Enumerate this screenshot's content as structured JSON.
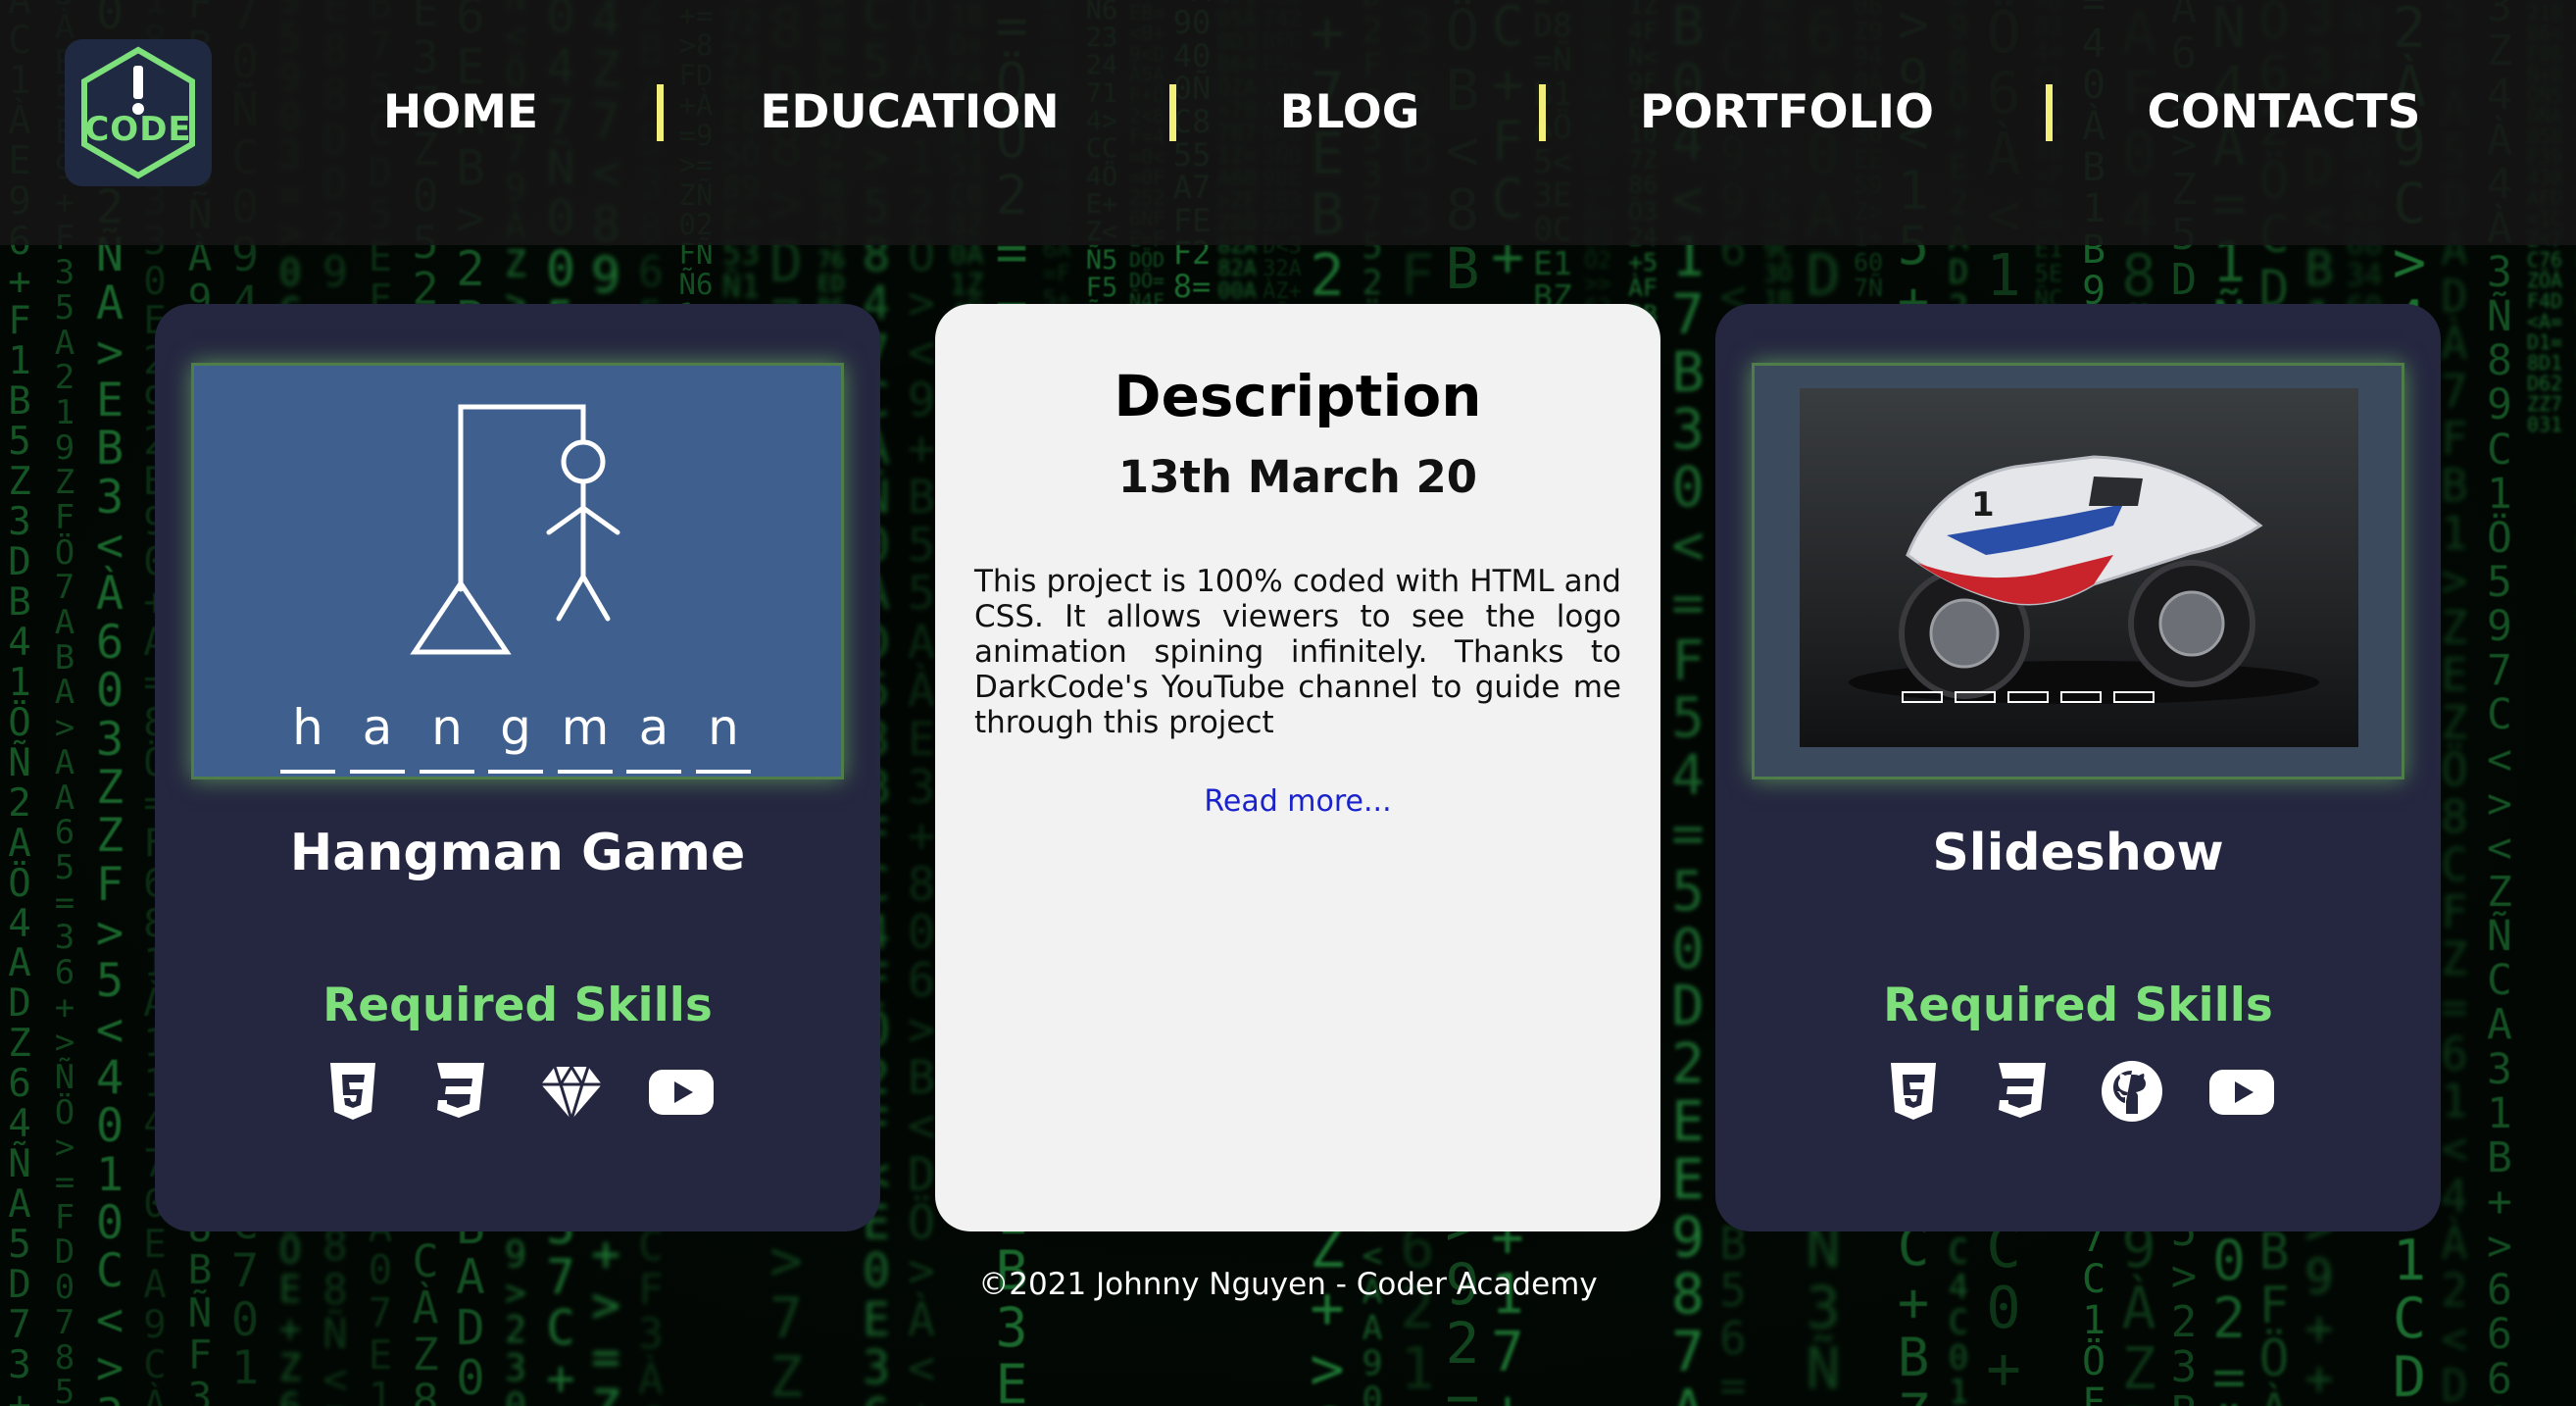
{
  "nav": {
    "logo_text": "CODE",
    "items": [
      {
        "label": "HOME"
      },
      {
        "label": "EDUCATION"
      },
      {
        "label": "BLOG"
      },
      {
        "label": "PORTFOLIO"
      },
      {
        "label": "CONTACTS"
      }
    ]
  },
  "cards": {
    "hangman": {
      "title": "Hangman Game",
      "skills_title": "Required Skills",
      "letters": [
        "h",
        "a",
        "n",
        "g",
        "m",
        "a",
        "n"
      ],
      "skills": [
        "html5-icon",
        "css3-icon",
        "sketch-icon",
        "youtube-icon"
      ]
    },
    "description": {
      "title": "Description",
      "date": "13th March 20",
      "body": "This project is 100% coded with HTML and CSS. It allows viewers to see the logo animation spining infinitely. Thanks to DarkCode's YouTube channel to guide me through this project",
      "read_more": "Read more..."
    },
    "slideshow": {
      "title": "Slideshow",
      "skills_title": "Required Skills",
      "skills": [
        "html5-icon",
        "css3-icon",
        "github-icon",
        "youtube-icon"
      ]
    }
  },
  "footer": {
    "text": "©2021 Johnny Nguyen - Coder Academy"
  },
  "colors": {
    "accent_green": "#7ee07a",
    "card_dark": "#252640",
    "separator_yellow": "#f2f07a",
    "link_blue": "#1a22cc"
  }
}
